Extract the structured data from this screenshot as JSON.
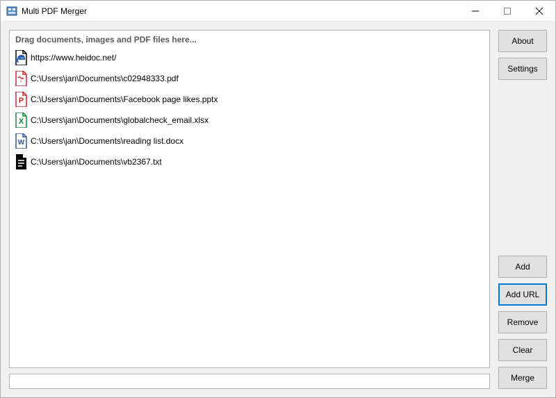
{
  "window": {
    "title": "Multi PDF Merger"
  },
  "dropArea": {
    "hint": "Drag documents, images and PDF files here..."
  },
  "files": [
    {
      "icon": "edge",
      "path": "https://www.heidoc.net/"
    },
    {
      "icon": "pdf",
      "path": "C:\\Users\\jan\\Documents\\c02948333.pdf"
    },
    {
      "icon": "ppt",
      "path": "C:\\Users\\jan\\Documents\\Facebook page likes.pptx"
    },
    {
      "icon": "xls",
      "path": "C:\\Users\\jan\\Documents\\globalcheck_email.xlsx"
    },
    {
      "icon": "doc",
      "path": "C:\\Users\\jan\\Documents\\reading list.docx"
    },
    {
      "icon": "txt",
      "path": "C:\\Users\\jan\\Documents\\vb2367.txt"
    }
  ],
  "buttons": {
    "about": "About",
    "settings": "Settings",
    "add": "Add",
    "addUrl": "Add URL",
    "remove": "Remove",
    "clear": "Clear",
    "merge": "Merge"
  }
}
